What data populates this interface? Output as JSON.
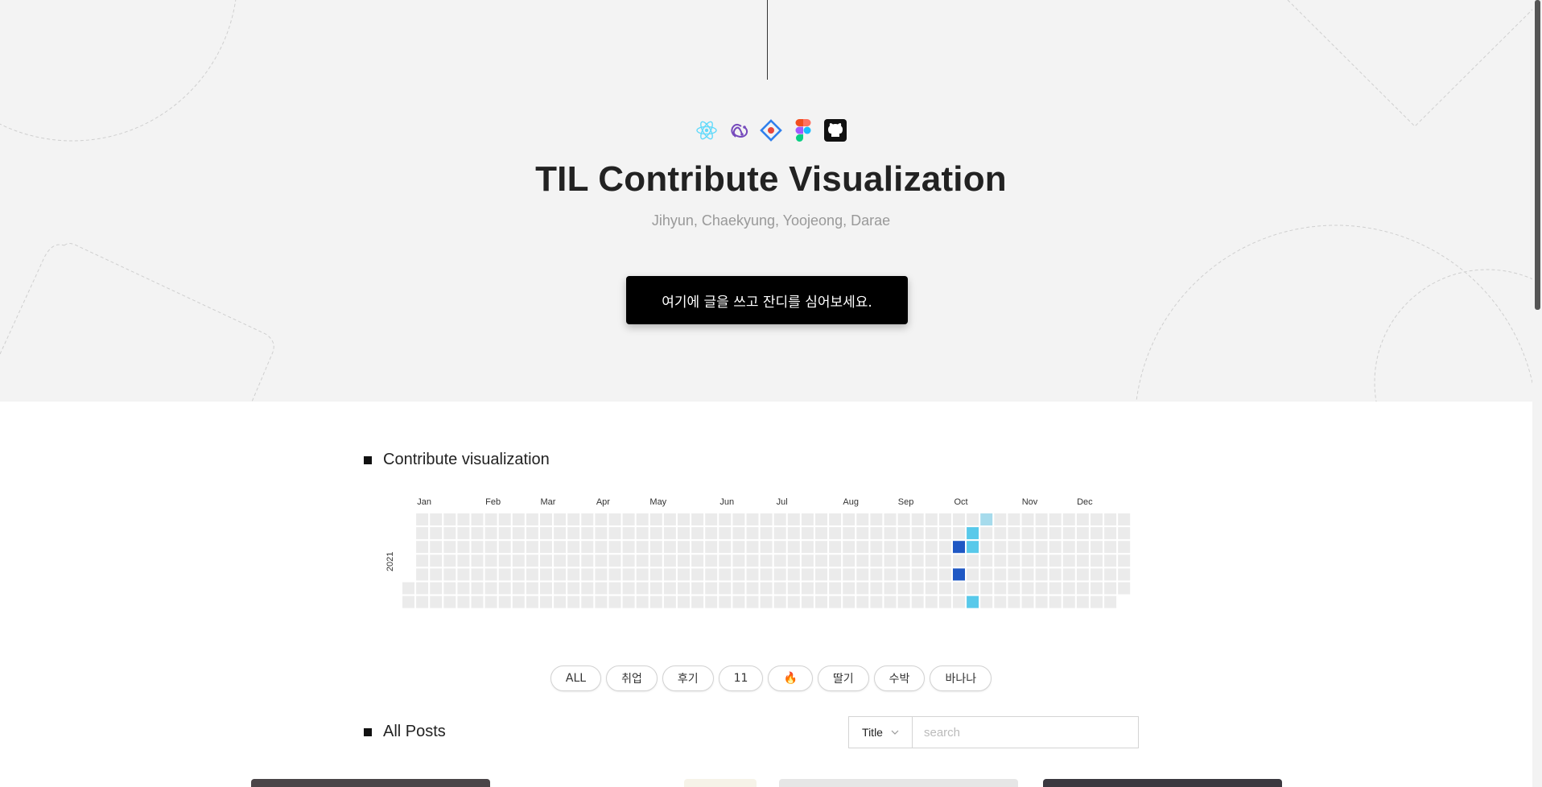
{
  "hero": {
    "icons": [
      "react-icon",
      "redux-icon",
      "jest-icon",
      "figma-icon",
      "github-icon"
    ],
    "title": "TIL Contribute Visualization",
    "subtitle": "Jihyun, Chaekyung, Yoojeong, Darae",
    "cta_label": "여기에 글을 쓰고 잔디를 심어보세요."
  },
  "contribute": {
    "title": "Contribute visualization",
    "year_label": "2021",
    "months": [
      "Jan",
      "Feb",
      "Mar",
      "Apr",
      "May",
      "Jun",
      "Jul",
      "Aug",
      "Sep",
      "Oct",
      "Nov",
      "Dec"
    ],
    "colors": {
      "empty": "#ebebeb",
      "level1": "#a6dbec",
      "level2": "#58c9ea",
      "level3": "#1f58c4"
    },
    "contributions": [
      {
        "week": 41,
        "day": 3,
        "level": 3
      },
      {
        "week": 41,
        "day": 5,
        "level": 3
      },
      {
        "week": 42,
        "day": 2,
        "level": 2
      },
      {
        "week": 42,
        "day": 3,
        "level": 2
      },
      {
        "week": 42,
        "day": 7,
        "level": 2
      },
      {
        "week": 43,
        "day": 1,
        "level": 1
      }
    ]
  },
  "tags": [
    "ALL",
    "취업",
    "후기",
    "11",
    "🔥",
    "딸기",
    "수박",
    "바나나"
  ],
  "posts": {
    "title": "All Posts",
    "search_select": "Title",
    "search_placeholder": "search"
  }
}
